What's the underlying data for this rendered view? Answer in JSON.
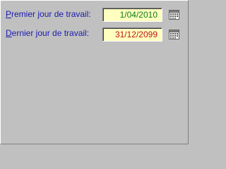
{
  "form": {
    "start": {
      "label_accel": "P",
      "label_rest": "remier jour de travail:",
      "value": "1/04/2010",
      "icon": "calendar-icon"
    },
    "end": {
      "label_accel": "D",
      "label_rest": "ernier jour de travail:",
      "value": "31/12/2099",
      "icon": "calendar-icon"
    }
  },
  "colors": {
    "background": "#c0c0c0",
    "label_text": "#1a1ab0",
    "field_background": "#ffffc0",
    "start_value_text": "#0c7a18",
    "end_value_text": "#c01010"
  }
}
